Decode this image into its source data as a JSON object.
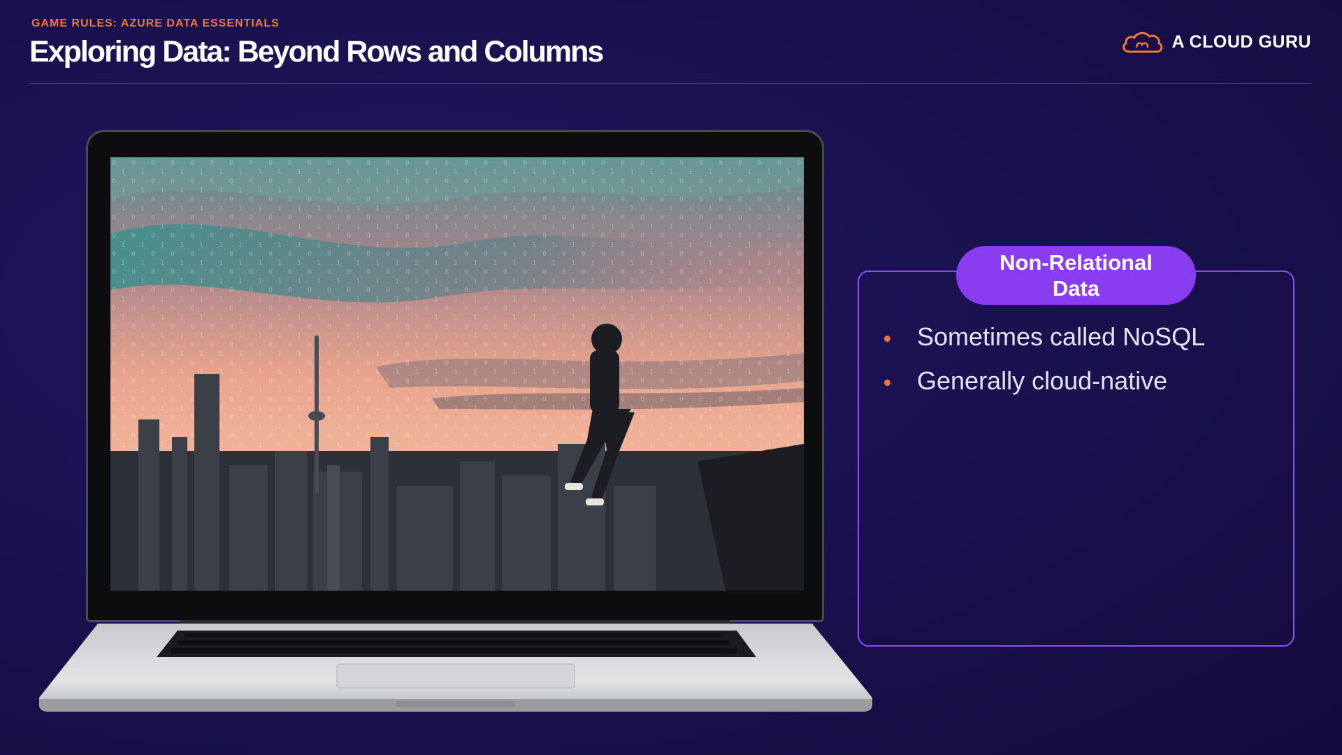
{
  "header": {
    "eyebrow": "GAME RULES: AZURE DATA ESSENTIALS",
    "title": "Exploring Data: Beyond Rows and Columns",
    "brand_name": "A CLOUD GURU",
    "brand_icon": "cloud-icon"
  },
  "card": {
    "heading": "Non-Relational Data",
    "bullets": [
      "Sometimes called NoSQL",
      "Generally cloud-native"
    ]
  },
  "colors": {
    "background": "#19104a",
    "accent_orange": "#f2763a",
    "accent_purple": "#8a3cf0",
    "card_border": "#8a4dff"
  }
}
